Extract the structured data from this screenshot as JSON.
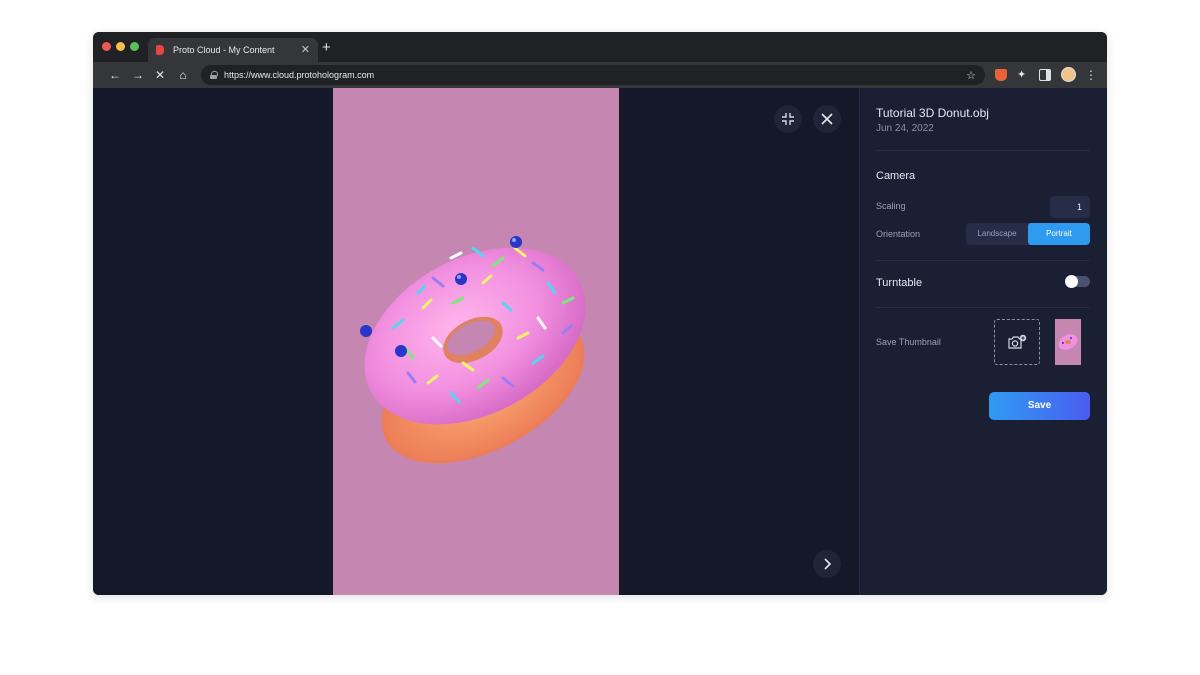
{
  "browser": {
    "tab_title": "Proto Cloud - My Content",
    "tab_close": "✕",
    "new_tab": "+",
    "url": "https://www.cloud.protohologram.com",
    "back": "←",
    "forward": "→",
    "stop": "✕",
    "home": "⌂",
    "star": "☆",
    "puzzle": "✦",
    "menu": "⋮"
  },
  "panel": {
    "file_name": "Tutorial 3D Donut.obj",
    "file_date": "Jun 24, 2022",
    "camera_title": "Camera",
    "scaling_label": "Scaling",
    "scaling_value": "1",
    "orientation_label": "Orientation",
    "orientation_options": [
      "Landscape",
      "Portrait"
    ],
    "orientation_selected": "Portrait",
    "turntable_label": "Turntable",
    "turntable_on": false,
    "save_thumbnail_label": "Save Thumbnail",
    "save_label": "Save"
  },
  "icons": {
    "minimize": "minimize-icon",
    "close": "close-icon",
    "next": "chevron-right-icon",
    "camera_add": "camera-add-icon"
  },
  "colors": {
    "accent": "#2e9af0",
    "canvas_bg": "#c686b2",
    "page_bg": "#141829",
    "panel_bg": "#1a1f33"
  }
}
